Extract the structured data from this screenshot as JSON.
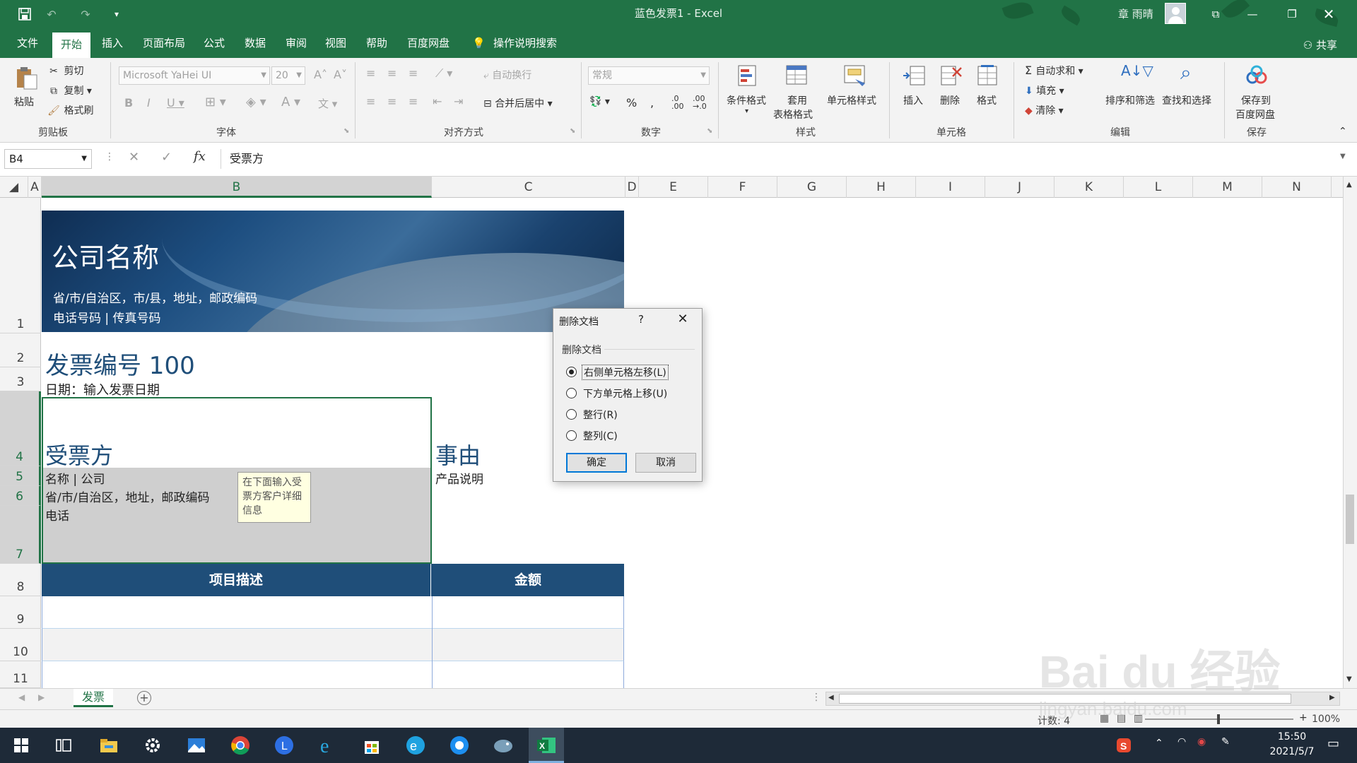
{
  "window": {
    "title": "蓝色发票1  -  Excel",
    "user": "章 雨晴"
  },
  "ribbon_tabs": [
    "文件",
    "开始",
    "插入",
    "页面布局",
    "公式",
    "数据",
    "审阅",
    "视图",
    "帮助",
    "百度网盘"
  ],
  "active_tab": "开始",
  "search_label": "操作说明搜索",
  "share_label": "共享",
  "clipboard": {
    "paste": "粘贴",
    "cut": "剪切",
    "copy": "复制",
    "format_painter": "格式刷",
    "group": "剪贴板"
  },
  "font": {
    "name": "Microsoft YaHei UI",
    "size": "20",
    "group": "字体"
  },
  "alignment": {
    "wrap": "自动换行",
    "merge": "合并后居中",
    "group": "对齐方式"
  },
  "number": {
    "format": "常规",
    "group": "数字"
  },
  "styles": {
    "conditional": "条件格式",
    "table_line1": "套用",
    "table_line2": "表格格式",
    "cell_styles": "单元格样式",
    "group": "样式"
  },
  "cells": {
    "insert": "插入",
    "delete": "删除",
    "format": "格式",
    "group": "单元格"
  },
  "editing": {
    "autosum": "自动求和",
    "fill": "填充",
    "clear": "清除",
    "sort": "排序和筛选",
    "find": "查找和选择",
    "group": "编辑"
  },
  "save": {
    "line1": "保存到",
    "line2": "百度网盘",
    "group": "保存"
  },
  "formula_bar": {
    "name_box": "B4",
    "content": "受票方"
  },
  "columns": [
    "A",
    "B",
    "C",
    "D",
    "E",
    "F",
    "G",
    "H",
    "I",
    "J",
    "K",
    "L",
    "M",
    "N"
  ],
  "rows": [
    "1",
    "2",
    "3",
    "4",
    "5",
    "6",
    "7",
    "8",
    "9",
    "10",
    "11"
  ],
  "sheet": {
    "company_name": "公司名称",
    "company_address": "省/市/自治区，市/县，地址，邮政编码",
    "company_phone": "电话号码 | 传真号码",
    "invoice_number": "发票编号 100",
    "invoice_date": "日期：输入发票日期",
    "recipient_title": "受票方",
    "recipient_name": "名称 | 公司",
    "recipient_address": "省/市/自治区，地址，邮政编码",
    "recipient_phone": "电话",
    "tooltip": "在下面输入受票方客户详细信息",
    "reason_title": "事由",
    "reason_desc": "产品说明",
    "table_header_desc": "项目描述",
    "table_header_amount": "金额"
  },
  "sheet_tab": "发票",
  "status": {
    "count": "计数: 4",
    "zoom": "100%"
  },
  "dialog": {
    "title": "删除文档",
    "help": "?",
    "group_label": "删除文档",
    "options": [
      "右侧单元格左移(L)",
      "下方单元格上移(U)",
      "整行(R)",
      "整列(C)"
    ],
    "selected_index": 0,
    "ok": "确定",
    "cancel": "取消"
  },
  "clock": {
    "time": "15:50",
    "date": "2021/5/7"
  },
  "watermark": {
    "text": "Bai du 经验",
    "sub": "jingyan.baidu.com"
  },
  "colors": {
    "excel_green": "#217346",
    "invoice_blue": "#1f4e79",
    "taskbar": "#1e2a38"
  }
}
